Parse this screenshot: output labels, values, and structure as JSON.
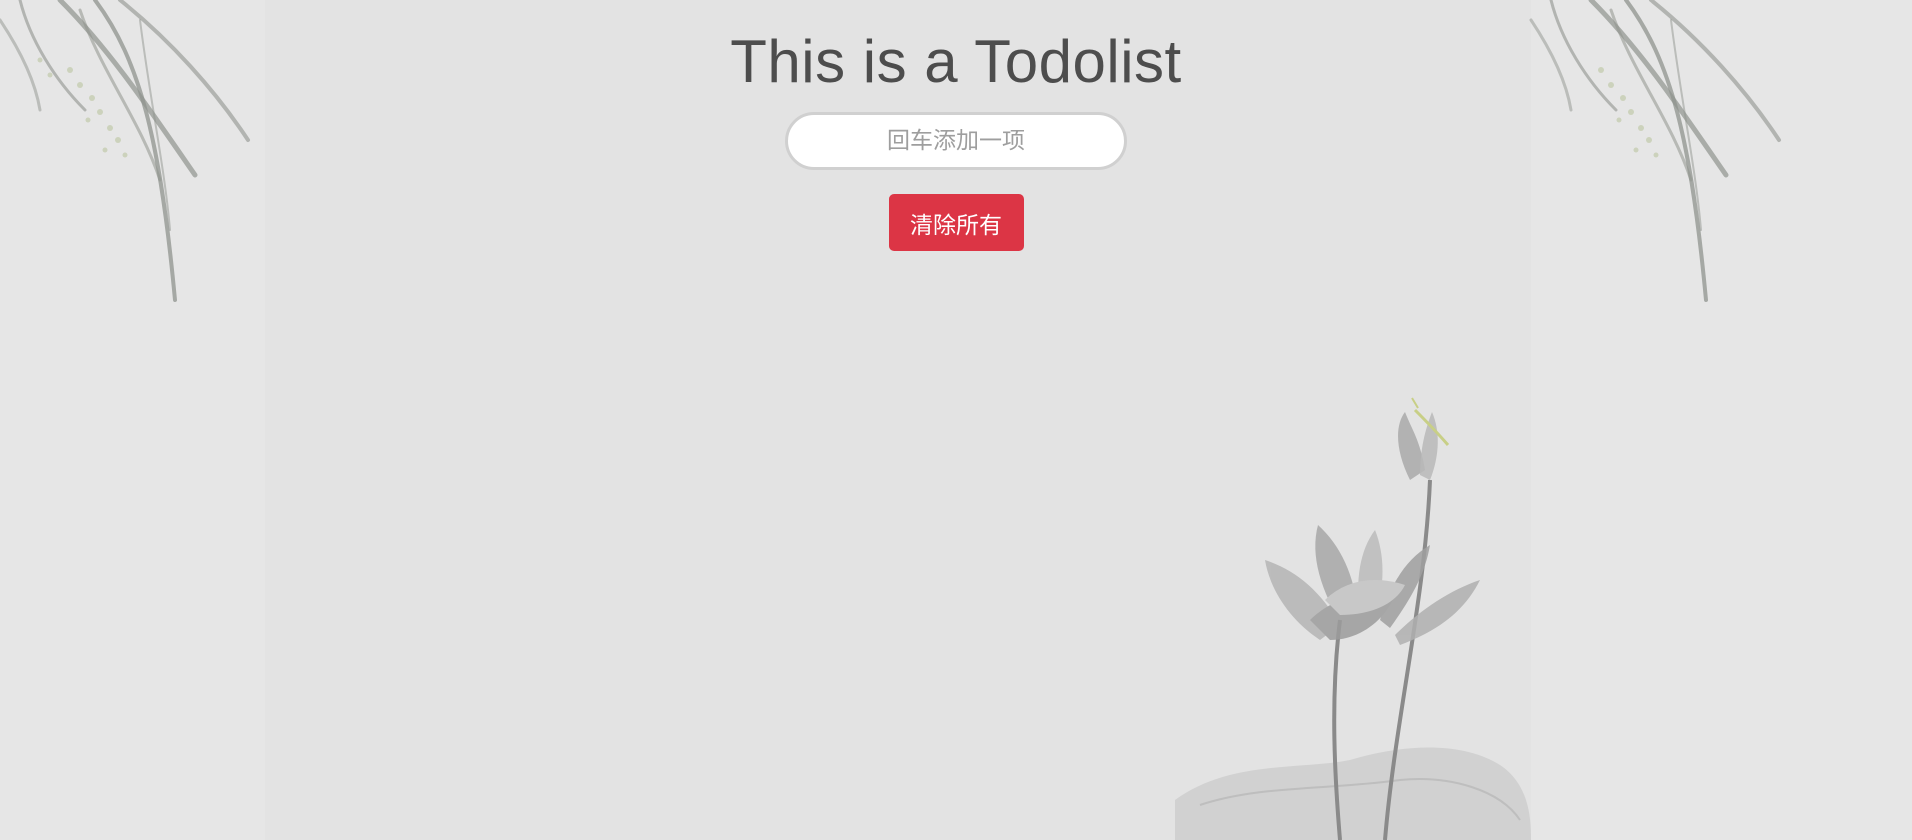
{
  "header": {
    "title": "This is a Todolist"
  },
  "todo_input": {
    "placeholder": "回车添加一项",
    "value": ""
  },
  "actions": {
    "clear_all_label": "清除所有"
  },
  "colors": {
    "background": "#e3e3e3",
    "title_text": "#4d4d4d",
    "clear_button": "#dc3545",
    "input_border": "#d0d0d0",
    "ink_painting": "#8a8a8a"
  },
  "decorations": {
    "left_art": "bamboo-leaves-ink-painting",
    "right_top_art": "bamboo-leaves-ink-painting",
    "bottom_art": "lotus-flower-ink-painting"
  }
}
